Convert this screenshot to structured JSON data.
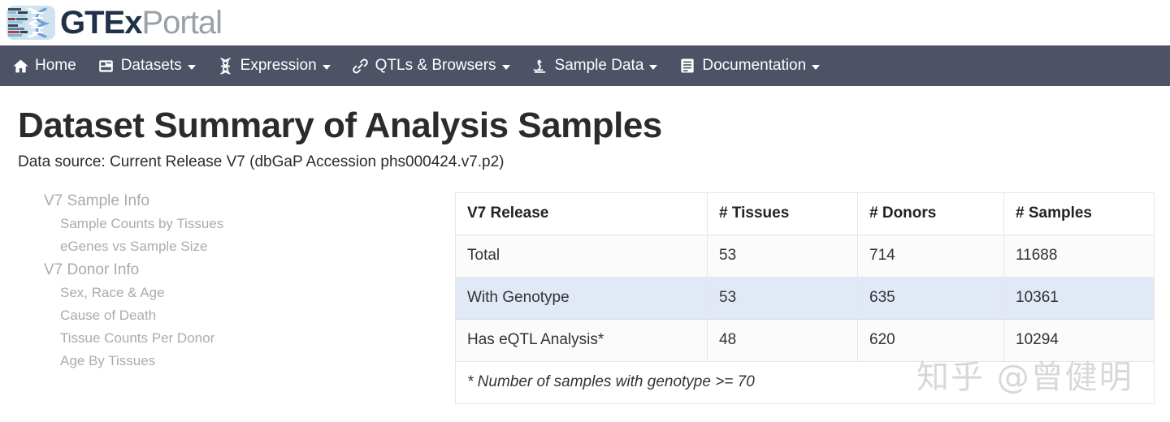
{
  "brand": {
    "logo_icon": "gtex-dna-heatmap-logo",
    "name_bold": "GTEx",
    "name_light": "Portal"
  },
  "nav": {
    "items": [
      {
        "label": "Home",
        "icon": "home-icon",
        "caret": false
      },
      {
        "label": "Datasets",
        "icon": "database-table-icon",
        "caret": true
      },
      {
        "label": "Expression",
        "icon": "dna-helix-icon",
        "caret": true
      },
      {
        "label": "QTLs & Browsers",
        "icon": "link-chain-icon",
        "caret": true
      },
      {
        "label": "Sample Data",
        "icon": "microscope-icon",
        "caret": true
      },
      {
        "label": "Documentation",
        "icon": "book-icon",
        "caret": true
      }
    ]
  },
  "page": {
    "title": "Dataset Summary of Analysis Samples",
    "subtitle": "Data source: Current Release V7 (dbGaP Accession phs000424.v7.p2)"
  },
  "sidebar": {
    "groups": [
      {
        "title": "V7 Sample Info",
        "items": [
          {
            "label": "Sample Counts by Tissues"
          },
          {
            "label": "eGenes vs Sample Size"
          }
        ]
      },
      {
        "title": "V7 Donor Info",
        "items": [
          {
            "label": "Sex, Race & Age"
          },
          {
            "label": "Cause of Death"
          },
          {
            "label": "Tissue Counts Per Donor"
          },
          {
            "label": "Age By Tissues"
          }
        ]
      }
    ]
  },
  "table": {
    "headers": [
      "V7 Release",
      "# Tissues",
      "# Donors",
      "# Samples"
    ],
    "rows": [
      {
        "name": "Total",
        "tissues": "53",
        "donors": "714",
        "samples": "11688"
      },
      {
        "name": "With Genotype",
        "tissues": "53",
        "donors": "635",
        "samples": "10361"
      },
      {
        "name": "Has eQTL Analysis*",
        "tissues": "48",
        "donors": "620",
        "samples": "10294"
      }
    ],
    "footnote": "* Number of samples with genotype >= 70"
  },
  "watermark": {
    "text": "知乎 @曾健明"
  },
  "colors": {
    "navbar": "#4d5266",
    "brand_dark": "#1f3049",
    "brand_light": "#9aa0a6",
    "row_highlight": "#e2e9f6",
    "sidebar_text": "#a9abae"
  }
}
